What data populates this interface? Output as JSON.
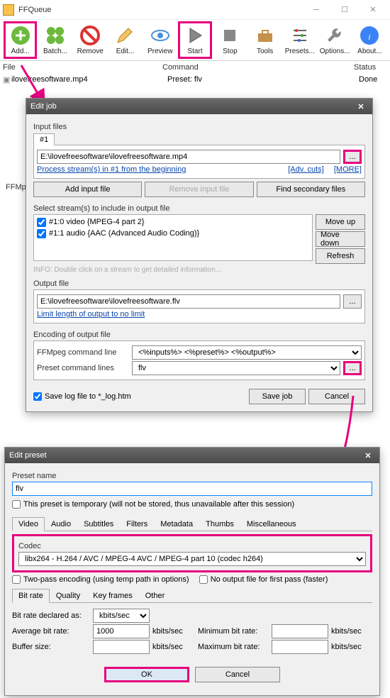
{
  "window": {
    "title": "FFQueue"
  },
  "toolbar": [
    {
      "label": "Add...",
      "icon": "plus",
      "hl": true
    },
    {
      "label": "Batch...",
      "icon": "plus4"
    },
    {
      "label": "Remove",
      "icon": "no"
    },
    {
      "label": "Edit...",
      "icon": "pencil"
    },
    {
      "label": "Preview",
      "icon": "eye"
    },
    {
      "label": "Start",
      "icon": "play",
      "hl": true
    },
    {
      "label": "Stop",
      "icon": "stop"
    },
    {
      "label": "Tools",
      "icon": "toolbox"
    },
    {
      "label": "Presets...",
      "icon": "sliders"
    },
    {
      "label": "Options...",
      "icon": "wrench"
    },
    {
      "label": "About...",
      "icon": "info"
    }
  ],
  "columns": {
    "file": "File",
    "command": "Command",
    "status": "Status"
  },
  "list": {
    "file": "ilovefreesoftware.mp4",
    "command": "Preset: flv",
    "status": "Done"
  },
  "ffmpeg_row_truncated": "FFMpe",
  "editjob": {
    "title": "Edit job",
    "input_files": "Input files",
    "tab1": "#1",
    "path": "E:\\ilovefreesoftware\\ilovefreesoftware.mp4",
    "process_link": "Process stream(s) in #1 from the beginning",
    "adv_cuts": "[Adv. cuts]",
    "more": "[MORE]",
    "add_input": "Add input file",
    "remove_input": "Remove input file",
    "find_secondary": "Find secondary files",
    "select_streams": "Select stream(s) to include in output file",
    "stream1": "#1:0 video {MPEG-4 part 2}",
    "stream2": "#1:1 audio {AAC (Advanced Audio Coding)}",
    "moveup": "Move up",
    "movedown": "Move down",
    "refresh": "Refresh",
    "info": "INFO: Double click on a stream to get detailed information...",
    "output_file": "Output file",
    "outpath": "E:\\ilovefreesoftware\\ilovefreesoftware.flv",
    "limit_link": "Limit length of output to no limit",
    "encoding": "Encoding of output file",
    "ffmpeg_cmd": "FFMpeg command line",
    "ffmpeg_val": "<%inputs%> <%preset%> <%output%>",
    "preset_cmd": "Preset command lines",
    "preset_val": "flv",
    "save_log": "Save log file to *_log.htm",
    "save_job": "Save job",
    "cancel": "Cancel"
  },
  "editpreset": {
    "title": "Edit preset",
    "preset_name": "Preset name",
    "name_val": "flv",
    "temp": "This preset is temporary (will not be stored, thus unavailable after this session)",
    "tabs": [
      "Video",
      "Audio",
      "Subtitles",
      "Filters",
      "Metadata",
      "Thumbs",
      "Miscellaneous"
    ],
    "codec": "Codec",
    "codec_val": "libx264 - H.264 / AVC / MPEG-4 AVC / MPEG-4 part 10 (codec h264)",
    "twopass": "Two-pass encoding (using temp path in options)",
    "nooutput": "No output file for first pass (faster)",
    "subtabs": [
      "Bit rate",
      "Quality",
      "Key frames",
      "Other"
    ],
    "declared": "Bit rate declared as:",
    "declared_val": "kbits/sec",
    "avg": "Average bit rate:",
    "avg_val": "1000",
    "unit": "kbits/sec",
    "buf": "Buffer size:",
    "min": "Minimum bit rate:",
    "max": "Maximum bit rate:",
    "ok": "OK",
    "cancel": "Cancel"
  }
}
